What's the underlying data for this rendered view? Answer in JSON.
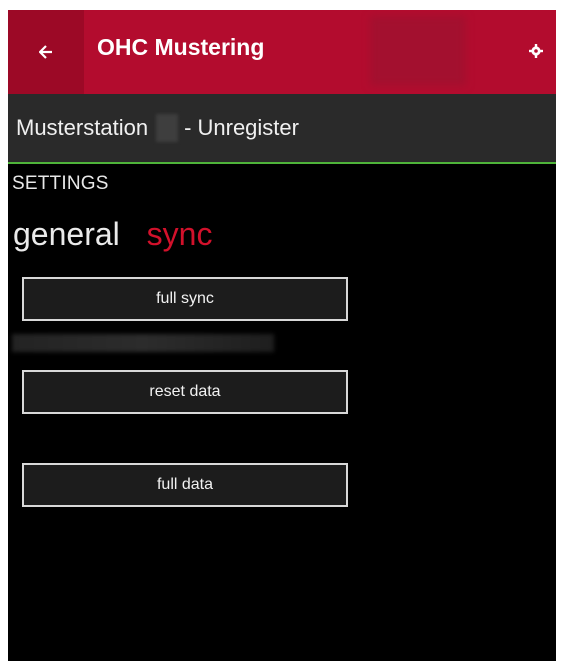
{
  "app": {
    "title": "OHC Mustering",
    "accent_color": "#b30c2e",
    "subheader_underline_color": "#4fb43a"
  },
  "header": {
    "back_icon": "back-arrow-icon",
    "settings_icon": "gear-icon"
  },
  "subheader": {
    "station_prefix": "Musterstation",
    "unregister_text": "- Unregister"
  },
  "page": {
    "section_title": "SETTINGS",
    "pivots": [
      {
        "label": "general",
        "active": false
      },
      {
        "label": "sync",
        "active": true
      }
    ]
  },
  "sync_panel": {
    "full_sync_label": "full sync",
    "reset_data_label": "reset data",
    "full_data_label": "full data"
  }
}
